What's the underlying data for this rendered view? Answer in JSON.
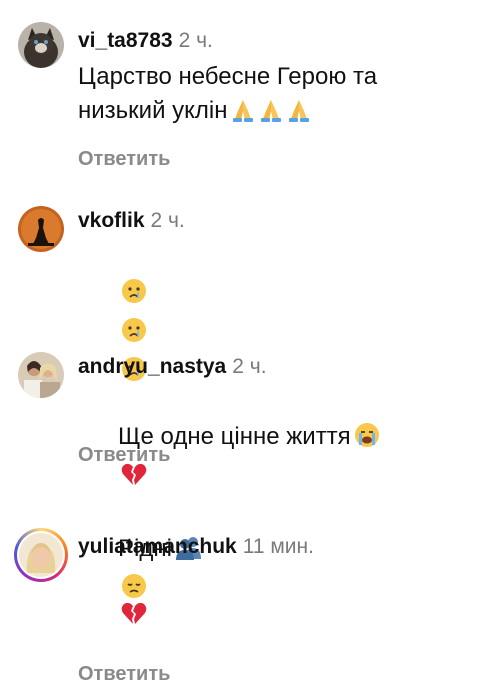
{
  "comments": [
    {
      "username": "vi_ta8783",
      "time": "2 ч.",
      "text": "Царство небесне Герою та\nнизький уклін",
      "emojis": [
        "folded-hands",
        "folded-hands",
        "folded-hands"
      ],
      "reply": "Ответить"
    },
    {
      "username": "vkoflik",
      "time": "2 ч.",
      "text": "",
      "emojis": [
        "crying-face",
        "crying-face",
        "crying-face"
      ],
      "reply": "Ответить"
    },
    {
      "username": "andryu_nastya",
      "time": "2 ч.",
      "line1": "Ще одне цінне життя",
      "line1_emojis": [
        "loudly-crying-face",
        "broken-heart"
      ],
      "line2": "Рідні",
      "line2_emojis": [
        "busts-in-silhouette",
        "disappointed-face"
      ],
      "reply": "Ответить"
    },
    {
      "username": "yuliatamanchuk",
      "time": "11 мин.",
      "emojis": [
        "broken-heart"
      ]
    }
  ]
}
